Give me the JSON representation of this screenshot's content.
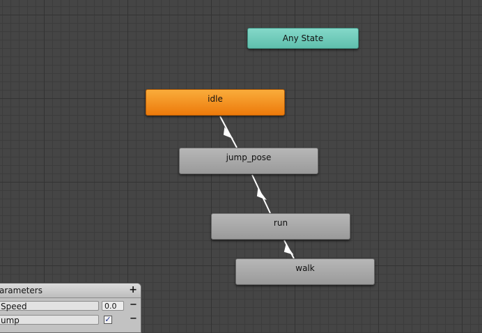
{
  "graph": {
    "nodes": {
      "any_state": {
        "label": "Any State",
        "color": "#6fcab9"
      },
      "idle": {
        "label": "idle",
        "color": "#f28f1f"
      },
      "jump_pose": {
        "label": "jump_pose",
        "color": "#a8a8a8"
      },
      "run": {
        "label": "run",
        "color": "#a8a8a8"
      },
      "walk": {
        "label": "walk",
        "color": "#a8a8a8"
      }
    },
    "transitions": [
      {
        "from": "idle",
        "to": "jump_pose"
      },
      {
        "from": "jump_pose",
        "to": "run"
      },
      {
        "from": "run",
        "to": "walk"
      }
    ]
  },
  "parameters_panel": {
    "title": "arameters",
    "add_icon": "plus-icon",
    "rows": [
      {
        "name": "Speed",
        "type": "float",
        "value": "0.0"
      },
      {
        "name": "ump",
        "type": "bool",
        "checked": true
      }
    ]
  }
}
